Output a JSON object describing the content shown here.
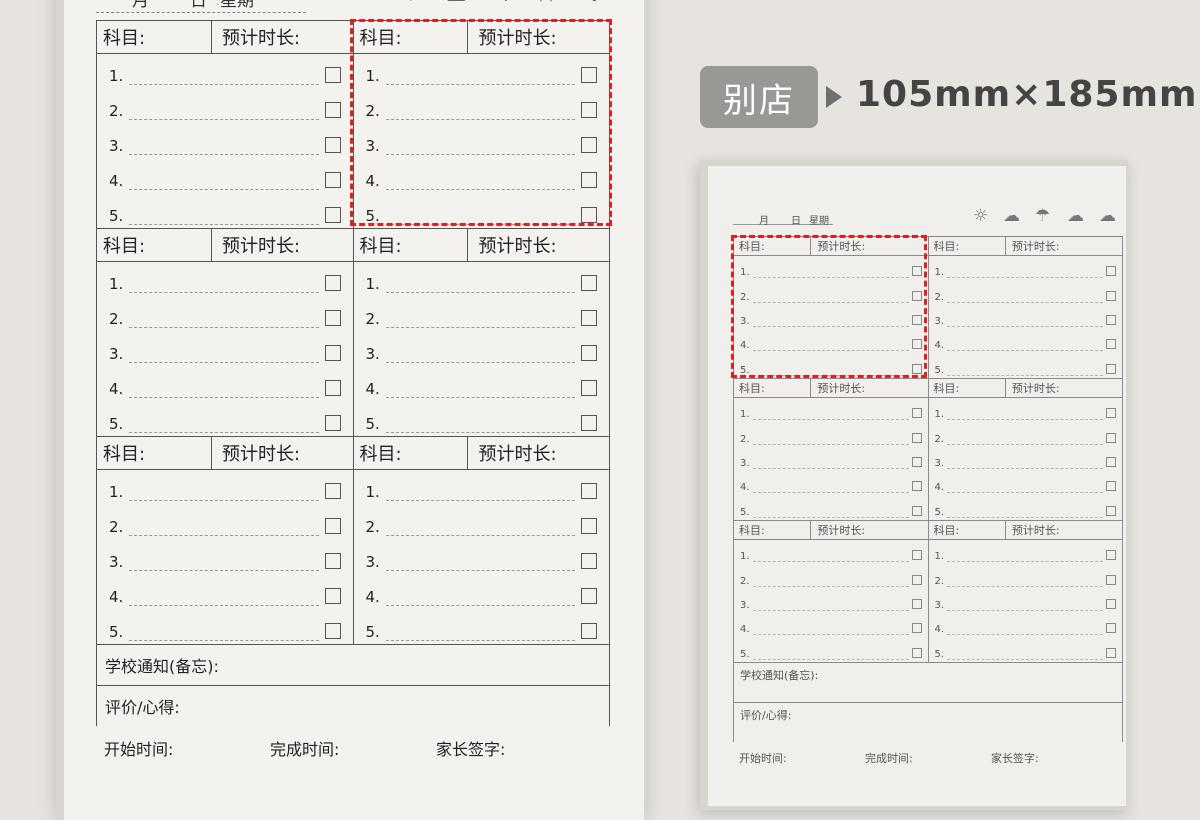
{
  "badge": {
    "label": "别店"
  },
  "dimensions": "105mm×185mm",
  "header": {
    "month": "月",
    "day": "日",
    "weekday": "星期",
    "weather_icons": [
      "sunny-icon",
      "partly-cloudy-icon",
      "thunder-icon",
      "rain-icon",
      "snow-icon"
    ]
  },
  "block": {
    "subject_label": "科目:",
    "duration_label": "预计时长:",
    "task_numbers": [
      "1.",
      "2.",
      "3.",
      "4.",
      "5."
    ]
  },
  "notes": {
    "school_notice": "学校通知(备忘):",
    "evaluation": "评价/心得:"
  },
  "footer": {
    "start_time": "开始时间:",
    "finish_time": "完成时间:",
    "parent_sign": "家长签字:"
  },
  "colors": {
    "highlight": "#e02020",
    "badge": "#9a9895"
  }
}
